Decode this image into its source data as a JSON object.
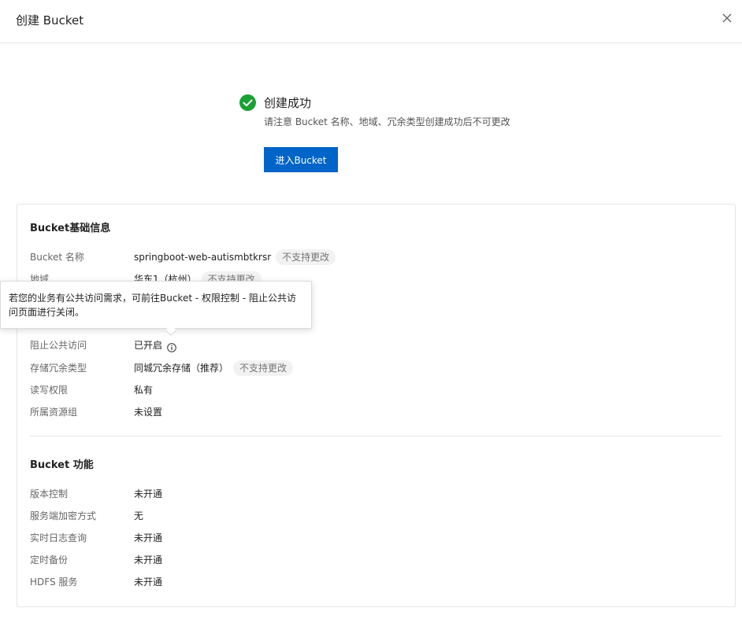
{
  "dialog": {
    "title": "创建 Bucket"
  },
  "success": {
    "title": "创建成功",
    "description": "请注意 Bucket 名称、地域、冗余类型创建成功后不可更改",
    "button_label": "进入Bucket"
  },
  "basic_info": {
    "title": "Bucket基础信息",
    "rows": [
      {
        "label": "Bucket 名称",
        "value": "springboot-web-autismbtkrsr",
        "tag": "不支持更改"
      },
      {
        "label": "地域",
        "value": "华东1（杭州）",
        "tag": "不支持更改"
      },
      {
        "label": "阻止公共访问",
        "value": "已开启"
      },
      {
        "label": "存储冗余类型",
        "value": "同城冗余存储（推荐）",
        "tag": "不支持更改"
      },
      {
        "label": "读写权限",
        "value": "私有"
      },
      {
        "label": "所属资源组",
        "value": "未设置"
      }
    ]
  },
  "features": {
    "title": "Bucket 功能",
    "rows": [
      {
        "label": "版本控制",
        "value": "未开通"
      },
      {
        "label": "服务端加密方式",
        "value": "无"
      },
      {
        "label": "实时日志查询",
        "value": "未开通"
      },
      {
        "label": "定时备份",
        "value": "未开通"
      },
      {
        "label": "HDFS 服务",
        "value": "未开通"
      }
    ]
  },
  "tooltip": {
    "text": "若您的业务有公共访问需求，可前往Bucket - 权限控制 - 阻止公共访问页面进行关闭。"
  },
  "colors": {
    "primary": "#0064c8",
    "success": "#1aa033",
    "tag_bg": "#f2f2f2"
  }
}
